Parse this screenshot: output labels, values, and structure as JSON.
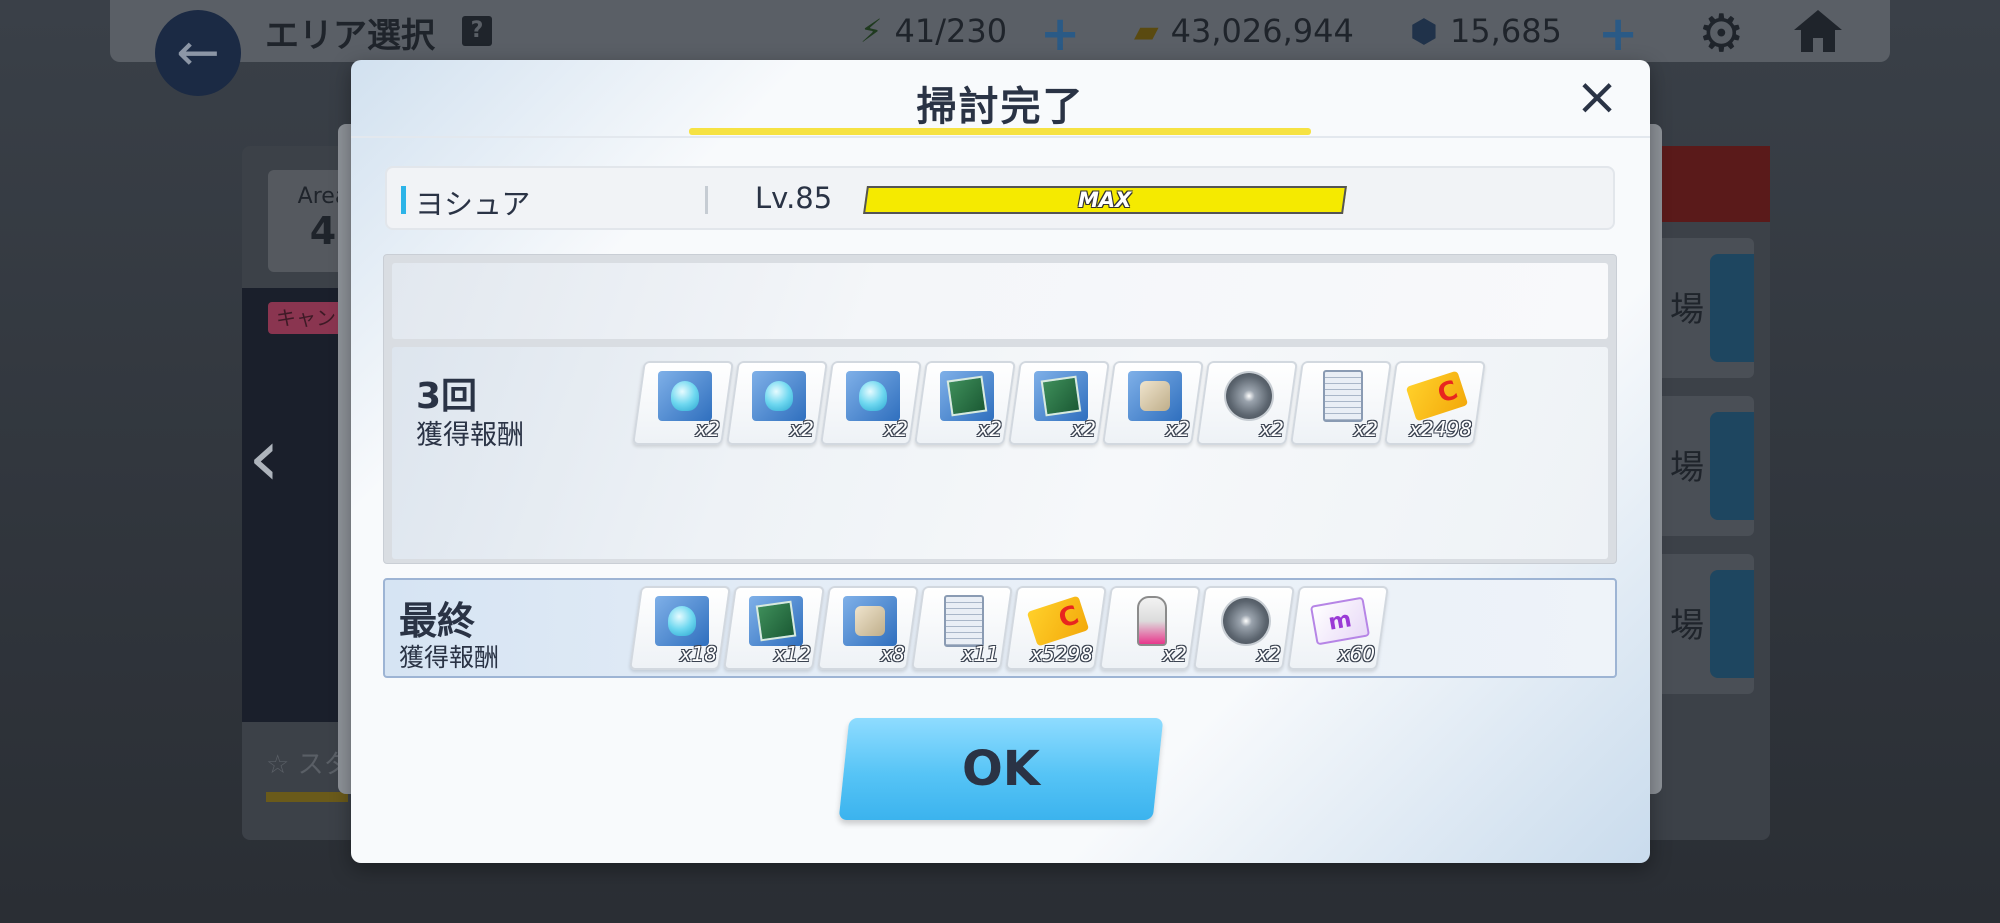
{
  "top_bar": {
    "title": "エリア選択",
    "help": "?",
    "stamina": "41/230",
    "credits": "43,026,944",
    "pyroxene": "15,685"
  },
  "background": {
    "area_label": "Area",
    "area_number": "4",
    "event_tag": "キャン",
    "stage_label": "スタ",
    "side_card_label": "場"
  },
  "modal": {
    "title": "掃討完了",
    "close_icon": "×",
    "character": {
      "name": "ヨシュア",
      "level": "Lv.85",
      "exp_label": "MAX",
      "exp_fraction": 1.0
    },
    "run": {
      "count": "3回",
      "sub_label": "獲得報酬",
      "items": [
        {
          "icon": "blue-artifact",
          "qty": "x2"
        },
        {
          "icon": "blue-artifact",
          "qty": "x2"
        },
        {
          "icon": "blue-artifact",
          "qty": "x2"
        },
        {
          "icon": "green-artifact",
          "qty": "x2"
        },
        {
          "icon": "green-artifact",
          "qty": "x2"
        },
        {
          "icon": "beige-artifact",
          "qty": "x2"
        },
        {
          "icon": "gray-sphere",
          "qty": "x2"
        },
        {
          "icon": "report-document",
          "qty": "x2"
        },
        {
          "icon": "credit-card",
          "qty": "x2498"
        }
      ]
    },
    "final": {
      "title": "最終",
      "sub_label": "獲得報酬",
      "items": [
        {
          "icon": "blue-artifact",
          "qty": "x18"
        },
        {
          "icon": "green-artifact",
          "qty": "x12"
        },
        {
          "icon": "beige-artifact",
          "qty": "x8"
        },
        {
          "icon": "report-document",
          "qty": "x11"
        },
        {
          "icon": "credit-card",
          "qty": "x5298"
        },
        {
          "icon": "pink-cone",
          "qty": "x2"
        },
        {
          "icon": "gray-sphere",
          "qty": "x2"
        },
        {
          "icon": "m-ticket",
          "qty": "x60"
        }
      ]
    },
    "ok_label": "OK"
  },
  "colors": {
    "accent_blue": "#2cb4e8",
    "exp_yellow": "#f5ea00",
    "ok_button": "#56c4f6",
    "title_underline": "#f6e243"
  }
}
